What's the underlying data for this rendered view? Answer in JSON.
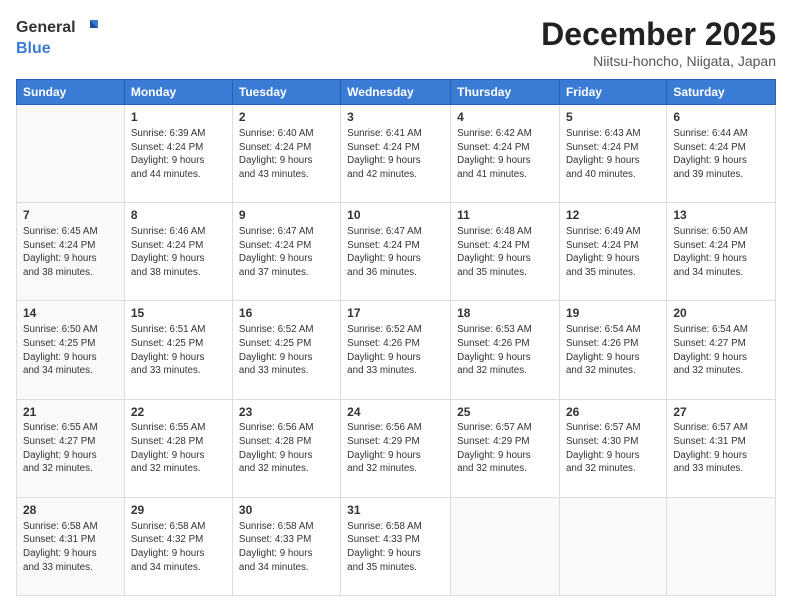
{
  "header": {
    "logo_general": "General",
    "logo_blue": "Blue",
    "month_title": "December 2025",
    "location": "Niitsu-honcho, Niigata, Japan"
  },
  "days_of_week": [
    "Sunday",
    "Monday",
    "Tuesday",
    "Wednesday",
    "Thursday",
    "Friday",
    "Saturday"
  ],
  "weeks": [
    [
      {
        "day": "",
        "info": ""
      },
      {
        "day": "1",
        "info": "Sunrise: 6:39 AM\nSunset: 4:24 PM\nDaylight: 9 hours\nand 44 minutes."
      },
      {
        "day": "2",
        "info": "Sunrise: 6:40 AM\nSunset: 4:24 PM\nDaylight: 9 hours\nand 43 minutes."
      },
      {
        "day": "3",
        "info": "Sunrise: 6:41 AM\nSunset: 4:24 PM\nDaylight: 9 hours\nand 42 minutes."
      },
      {
        "day": "4",
        "info": "Sunrise: 6:42 AM\nSunset: 4:24 PM\nDaylight: 9 hours\nand 41 minutes."
      },
      {
        "day": "5",
        "info": "Sunrise: 6:43 AM\nSunset: 4:24 PM\nDaylight: 9 hours\nand 40 minutes."
      },
      {
        "day": "6",
        "info": "Sunrise: 6:44 AM\nSunset: 4:24 PM\nDaylight: 9 hours\nand 39 minutes."
      }
    ],
    [
      {
        "day": "7",
        "info": ""
      },
      {
        "day": "8",
        "info": "Sunrise: 6:46 AM\nSunset: 4:24 PM\nDaylight: 9 hours\nand 38 minutes."
      },
      {
        "day": "9",
        "info": "Sunrise: 6:47 AM\nSunset: 4:24 PM\nDaylight: 9 hours\nand 37 minutes."
      },
      {
        "day": "10",
        "info": "Sunrise: 6:47 AM\nSunset: 4:24 PM\nDaylight: 9 hours\nand 36 minutes."
      },
      {
        "day": "11",
        "info": "Sunrise: 6:48 AM\nSunset: 4:24 PM\nDaylight: 9 hours\nand 35 minutes."
      },
      {
        "day": "12",
        "info": "Sunrise: 6:49 AM\nSunset: 4:24 PM\nDaylight: 9 hours\nand 35 minutes."
      },
      {
        "day": "13",
        "info": "Sunrise: 6:50 AM\nSunset: 4:24 PM\nDaylight: 9 hours\nand 34 minutes."
      }
    ],
    [
      {
        "day": "14",
        "info": ""
      },
      {
        "day": "15",
        "info": "Sunrise: 6:51 AM\nSunset: 4:25 PM\nDaylight: 9 hours\nand 33 minutes."
      },
      {
        "day": "16",
        "info": "Sunrise: 6:52 AM\nSunset: 4:25 PM\nDaylight: 9 hours\nand 33 minutes."
      },
      {
        "day": "17",
        "info": "Sunrise: 6:52 AM\nSunset: 4:26 PM\nDaylight: 9 hours\nand 33 minutes."
      },
      {
        "day": "18",
        "info": "Sunrise: 6:53 AM\nSunset: 4:26 PM\nDaylight: 9 hours\nand 32 minutes."
      },
      {
        "day": "19",
        "info": "Sunrise: 6:54 AM\nSunset: 4:26 PM\nDaylight: 9 hours\nand 32 minutes."
      },
      {
        "day": "20",
        "info": "Sunrise: 6:54 AM\nSunset: 4:27 PM\nDaylight: 9 hours\nand 32 minutes."
      }
    ],
    [
      {
        "day": "21",
        "info": ""
      },
      {
        "day": "22",
        "info": "Sunrise: 6:55 AM\nSunset: 4:28 PM\nDaylight: 9 hours\nand 32 minutes."
      },
      {
        "day": "23",
        "info": "Sunrise: 6:56 AM\nSunset: 4:28 PM\nDaylight: 9 hours\nand 32 minutes."
      },
      {
        "day": "24",
        "info": "Sunrise: 6:56 AM\nSunset: 4:29 PM\nDaylight: 9 hours\nand 32 minutes."
      },
      {
        "day": "25",
        "info": "Sunrise: 6:57 AM\nSunset: 4:29 PM\nDaylight: 9 hours\nand 32 minutes."
      },
      {
        "day": "26",
        "info": "Sunrise: 6:57 AM\nSunset: 4:30 PM\nDaylight: 9 hours\nand 32 minutes."
      },
      {
        "day": "27",
        "info": "Sunrise: 6:57 AM\nSunset: 4:31 PM\nDaylight: 9 hours\nand 33 minutes."
      }
    ],
    [
      {
        "day": "28",
        "info": "Sunrise: 6:58 AM\nSunset: 4:31 PM\nDaylight: 9 hours\nand 33 minutes."
      },
      {
        "day": "29",
        "info": "Sunrise: 6:58 AM\nSunset: 4:32 PM\nDaylight: 9 hours\nand 34 minutes."
      },
      {
        "day": "30",
        "info": "Sunrise: 6:58 AM\nSunset: 4:33 PM\nDaylight: 9 hours\nand 34 minutes."
      },
      {
        "day": "31",
        "info": "Sunrise: 6:58 AM\nSunset: 4:33 PM\nDaylight: 9 hours\nand 35 minutes."
      },
      {
        "day": "",
        "info": ""
      },
      {
        "day": "",
        "info": ""
      },
      {
        "day": "",
        "info": ""
      }
    ]
  ],
  "week7_sunday_info": "Sunrise: 6:45 AM\nSunset: 4:24 PM\nDaylight: 9 hours\nand 38 minutes.",
  "week14_sunday_info": "Sunrise: 6:50 AM\nSunset: 4:25 PM\nDaylight: 9 hours\nand 34 minutes.",
  "week21_sunday_info": "Sunrise: 6:55 AM\nSunset: 4:27 PM\nDaylight: 9 hours\nand 32 minutes."
}
